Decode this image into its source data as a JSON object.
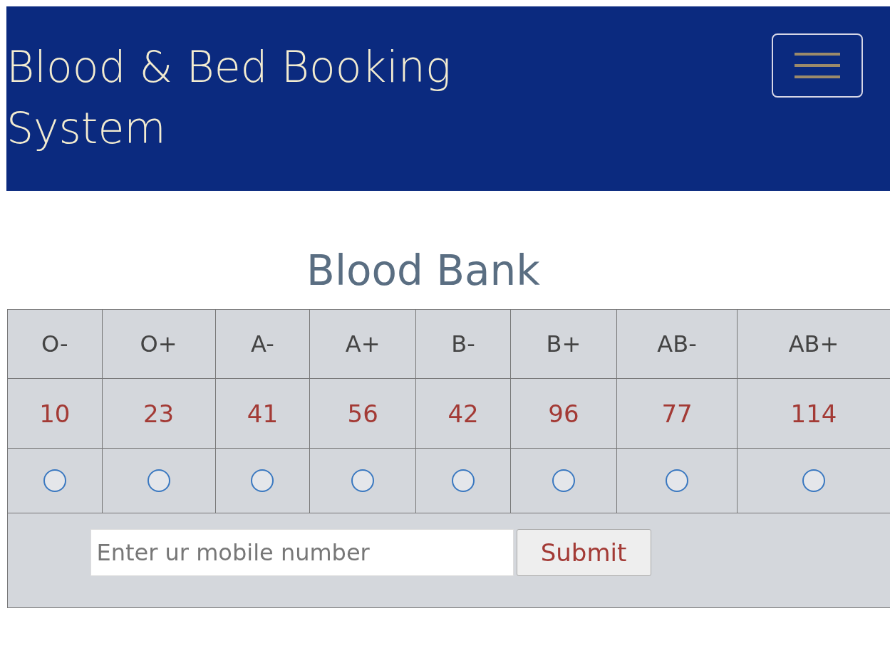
{
  "navbar": {
    "title": "Blood & Bed Booking System",
    "menu_button": {
      "kind": "hamburger"
    }
  },
  "heading": "Blood Bank",
  "table": {
    "columns": [
      "O-",
      "O+",
      "A-",
      "A+",
      "B-",
      "B+",
      "AB-",
      "AB+"
    ],
    "counts": [
      "10",
      "23",
      "41",
      "56",
      "42",
      "96",
      "77",
      "114"
    ],
    "radios": [
      {
        "selected": false
      },
      {
        "selected": false
      },
      {
        "selected": false
      },
      {
        "selected": false
      },
      {
        "selected": false
      },
      {
        "selected": false
      },
      {
        "selected": false
      },
      {
        "selected": false
      }
    ]
  },
  "form": {
    "placeholder": "Enter ur mobile number",
    "button": "Submit"
  }
}
